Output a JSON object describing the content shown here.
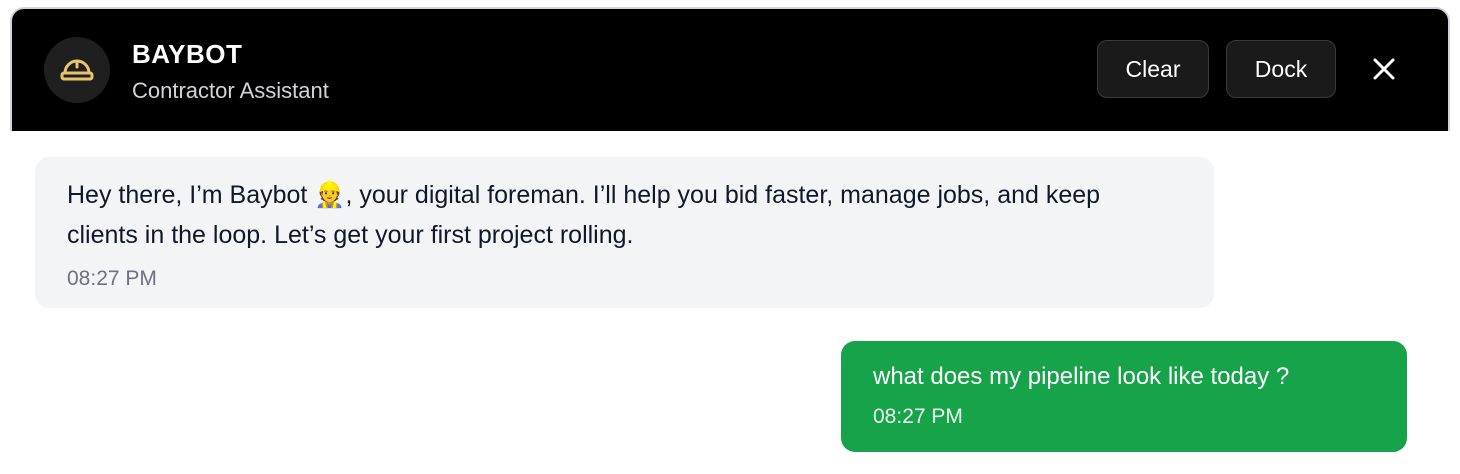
{
  "header": {
    "title": "BAYBOT",
    "subtitle": "Contractor Assistant",
    "avatar_icon": "hard-hat-icon",
    "accent_color": "#e8c46a",
    "clear_label": "Clear",
    "dock_label": "Dock",
    "close_icon": "close-icon"
  },
  "messages": [
    {
      "sender": "bot",
      "text": "Hey there, I’m Baybot 👷, your digital foreman. I’ll help you bid faster, manage jobs, and keep clients in the loop. Let’s get your first project rolling.",
      "time": "08:27 PM",
      "bubble_color": "#f3f4f6"
    },
    {
      "sender": "user",
      "text": "what does my pipeline look like today ?",
      "time": "08:27 PM",
      "bubble_color": "#16a34a"
    }
  ]
}
